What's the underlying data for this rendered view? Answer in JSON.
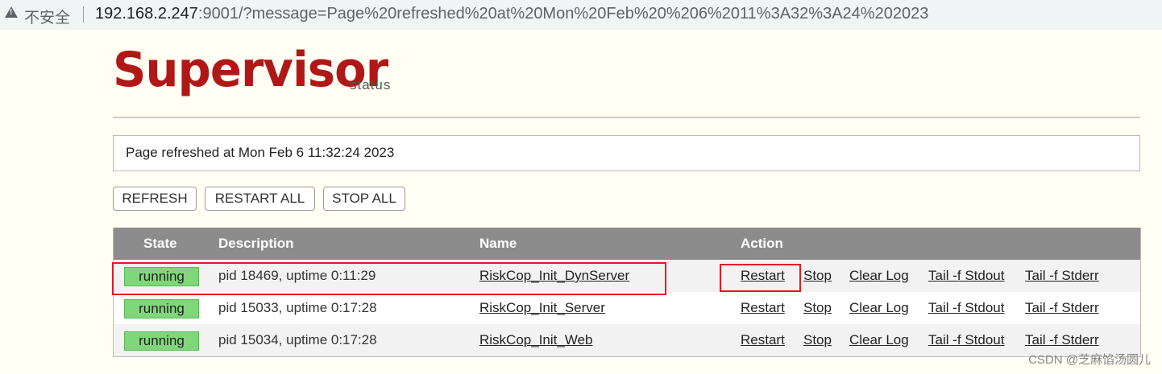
{
  "browser": {
    "security_label": "不安全",
    "url_host": "192.168.2.247",
    "url_rest": ":9001/?message=Page%20refreshed%20at%20Mon%20Feb%20%206%2011%3A32%3A24%202023"
  },
  "header": {
    "logo": "Supervisor",
    "logo_sub": "status"
  },
  "message": "Page refreshed at Mon Feb 6 11:32:24 2023",
  "buttons": {
    "refresh": "REFRESH",
    "restart_all": "RESTART ALL",
    "stop_all": "STOP ALL"
  },
  "table": {
    "columns": [
      "State",
      "Description",
      "Name",
      "Action"
    ],
    "rows": [
      {
        "state": "running",
        "description": "pid 18469, uptime 0:11:29",
        "name": "RiskCop_Init_DynServer"
      },
      {
        "state": "running",
        "description": "pid 15033, uptime 0:17:28",
        "name": "RiskCop_Init_Server"
      },
      {
        "state": "running",
        "description": "pid 15034, uptime 0:17:28",
        "name": "RiskCop_Init_Web"
      }
    ],
    "actions": {
      "restart": "Restart",
      "stop": "Stop",
      "clear_log": "Clear Log",
      "tail_stdout": "Tail -f Stdout",
      "tail_stderr": "Tail -f Stderr"
    }
  },
  "watermark": "CSDN @芝麻馅汤圆儿",
  "colors": {
    "logo_red": "#b01818",
    "header_gray": "#8c8c8c",
    "running_green": "#7fd77a",
    "highlight_red": "#e01b24"
  }
}
